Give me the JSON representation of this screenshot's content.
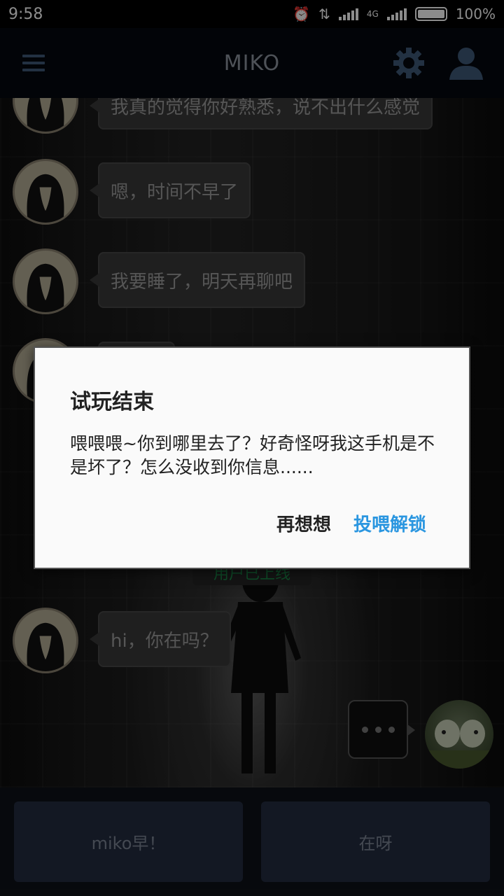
{
  "status_bar": {
    "time": "9:58",
    "network": "4G",
    "battery": "100%"
  },
  "app_bar": {
    "title": "MIKO"
  },
  "messages": [
    {
      "text": "我真的觉得你好熟悉，说不出什么感觉"
    },
    {
      "text": "嗯，时间不早了"
    },
    {
      "text": "我要睡了，明天再聊吧"
    },
    {
      "text": ""
    },
    {
      "text": "hi，你在吗？"
    }
  ],
  "system_notice": "用户已上线",
  "reply_options": [
    "miko早！",
    "在呀"
  ],
  "dialog": {
    "title": "试玩结束",
    "body": "喂喂喂~你到哪里去了？好奇怪呀我这手机是不是坏了？怎么没收到你信息......",
    "cancel": "再想想",
    "confirm": "投喂解锁"
  },
  "colors": {
    "accent": "#2a96e0",
    "app_bar_icon": "#3e5a78",
    "system_text": "#1b8a4a"
  }
}
